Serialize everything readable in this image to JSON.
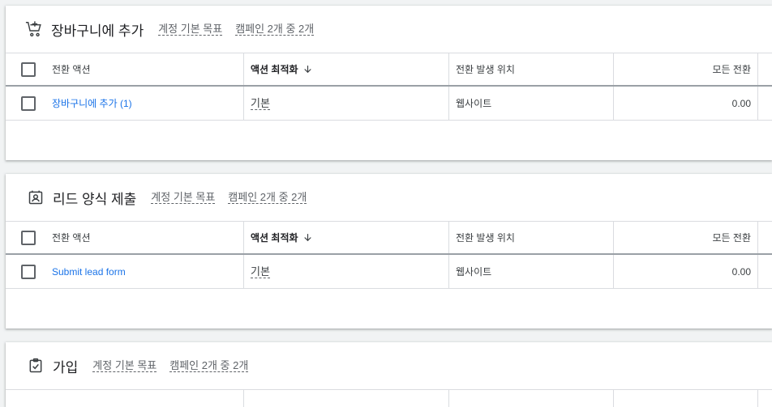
{
  "sections": [
    {
      "title": "장바구니에 추가",
      "icon": "add-shopping-cart-icon",
      "goal_link": "계정 기본 목표",
      "campaign_link": "캠페인 2개 중 2개",
      "columns": {
        "conversion_action": "전환 액션",
        "action_optimization": "액션 최적화",
        "conversion_source": "전환 발생 위치",
        "all_conversions": "모든 전환"
      },
      "rows": [
        {
          "name": "장바구니에 추가 (1)",
          "optimization": "기본",
          "source": "웹사이트",
          "all_conversions": "0.00"
        }
      ]
    },
    {
      "title": "리드 양식 제출",
      "icon": "contact-form-icon",
      "goal_link": "계정 기본 목표",
      "campaign_link": "캠페인 2개 중 2개",
      "columns": {
        "conversion_action": "전환 액션",
        "action_optimization": "액션 최적화",
        "conversion_source": "전환 발생 위치",
        "all_conversions": "모든 전환"
      },
      "rows": [
        {
          "name": "Submit lead form",
          "optimization": "기본",
          "source": "웹사이트",
          "all_conversions": "0.00"
        }
      ]
    },
    {
      "title": "가입",
      "icon": "clipboard-check-icon",
      "goal_link": "계정 기본 목표",
      "campaign_link": "캠페인 2개 중 2개"
    }
  ],
  "colors": {
    "link": "#1a73e8",
    "text": "#202124",
    "secondary_text": "#5f6368",
    "background": "#f1f3f4"
  }
}
